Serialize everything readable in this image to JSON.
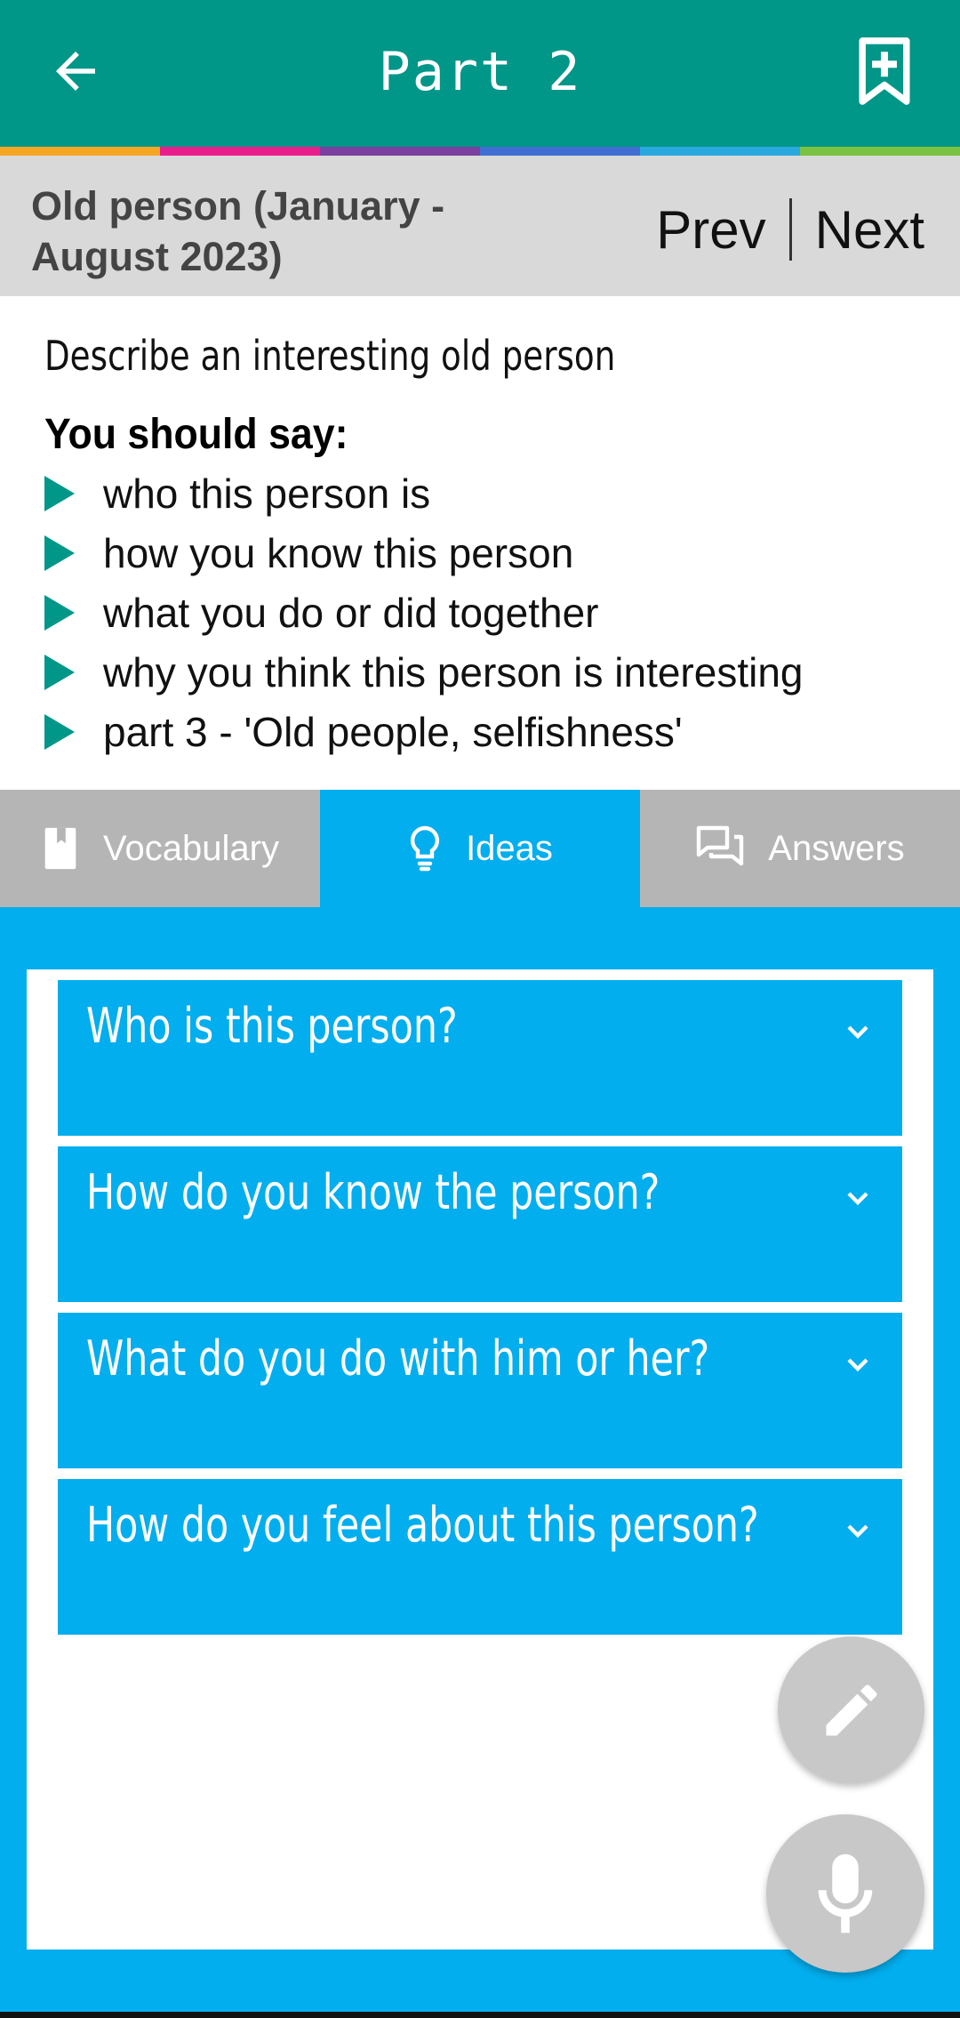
{
  "appbar": {
    "title": "Part 2",
    "back_icon": "arrow-back-icon",
    "bookmark_icon": "bookmark-add-icon"
  },
  "stripe_colors": [
    "#F5A623",
    "#E91E8C",
    "#7B3FA0",
    "#3F6FD1",
    "#29A8E0",
    "#7CC242"
  ],
  "topic": {
    "title": "Old person (January - August 2023)",
    "prev_label": "Prev",
    "next_label": "Next"
  },
  "cue_card": {
    "description": "Describe an interesting old person",
    "should_say": "You should say:",
    "points": [
      "who this person is",
      "how you know this person",
      "what you do or did together",
      "why you think this person is interesting",
      "part 3 - 'Old people, selfishness'"
    ]
  },
  "tabs": [
    {
      "label": "Vocabulary",
      "icon": "book-icon",
      "active": false
    },
    {
      "label": "Ideas",
      "icon": "lightbulb-icon",
      "active": true
    },
    {
      "label": "Answers",
      "icon": "chat-bubbles-icon",
      "active": false
    }
  ],
  "ideas": [
    "Who is this person?",
    "How do you know the person?",
    "What do you do with him or her?",
    "How do you feel about this person?"
  ],
  "fabs": {
    "edit_icon": "pencil-icon",
    "mic_icon": "microphone-icon"
  },
  "colors": {
    "primary": "#009688",
    "accent": "#03AEEE",
    "tab_inactive": "#B5B5B5",
    "topic_bg": "#D9D9D9"
  }
}
